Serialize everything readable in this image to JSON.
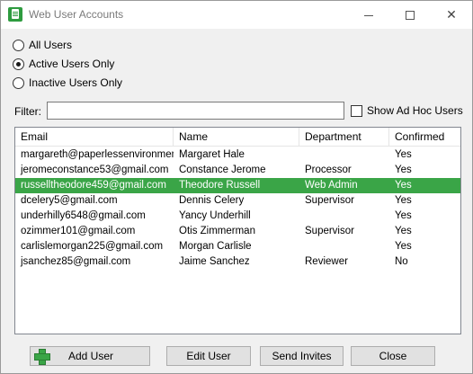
{
  "window": {
    "title": "Web User Accounts"
  },
  "filter_options": [
    {
      "label": "All Users",
      "checked": false
    },
    {
      "label": "Active Users Only",
      "checked": true
    },
    {
      "label": "Inactive Users Only",
      "checked": false
    }
  ],
  "filter": {
    "label": "Filter:",
    "value": ""
  },
  "show_adhoc": {
    "label": "Show Ad Hoc Users",
    "checked": false
  },
  "table": {
    "columns": [
      "Email",
      "Name",
      "Department",
      "Confirmed"
    ],
    "rows": [
      {
        "email": "margareth@paperlessenvironmen...",
        "name": "Margaret Hale",
        "department": "",
        "confirmed": "Yes",
        "selected": false
      },
      {
        "email": "jeromeconstance53@gmail.com",
        "name": "Constance Jerome",
        "department": "Processor",
        "confirmed": "Yes",
        "selected": false
      },
      {
        "email": "russelltheodore459@gmail.com",
        "name": "Theodore Russell",
        "department": "Web Admin",
        "confirmed": "Yes",
        "selected": true
      },
      {
        "email": "dcelery5@gmail.com",
        "name": "Dennis Celery",
        "department": "Supervisor",
        "confirmed": "Yes",
        "selected": false
      },
      {
        "email": "underhilly6548@gmail.com",
        "name": "Yancy Underhill",
        "department": "",
        "confirmed": "Yes",
        "selected": false
      },
      {
        "email": "ozimmer101@gmail.com",
        "name": "Otis Zimmerman",
        "department": "Supervisor",
        "confirmed": "Yes",
        "selected": false
      },
      {
        "email": "carlislemorgan225@gmail.com",
        "name": "Morgan Carlisle",
        "department": "",
        "confirmed": "Yes",
        "selected": false
      },
      {
        "email": "jsanchez85@gmail.com",
        "name": "Jaime Sanchez",
        "department": "Reviewer",
        "confirmed": "No",
        "selected": false
      }
    ]
  },
  "buttons": {
    "add_user": "Add User",
    "edit_user": "Edit User",
    "send_invites": "Send Invites",
    "close": "Close"
  },
  "colors": {
    "selection": "#3aa547",
    "accent_icon": "#2e9b3f"
  },
  "icons": {
    "app": "document-icon",
    "add": "plus-icon"
  }
}
